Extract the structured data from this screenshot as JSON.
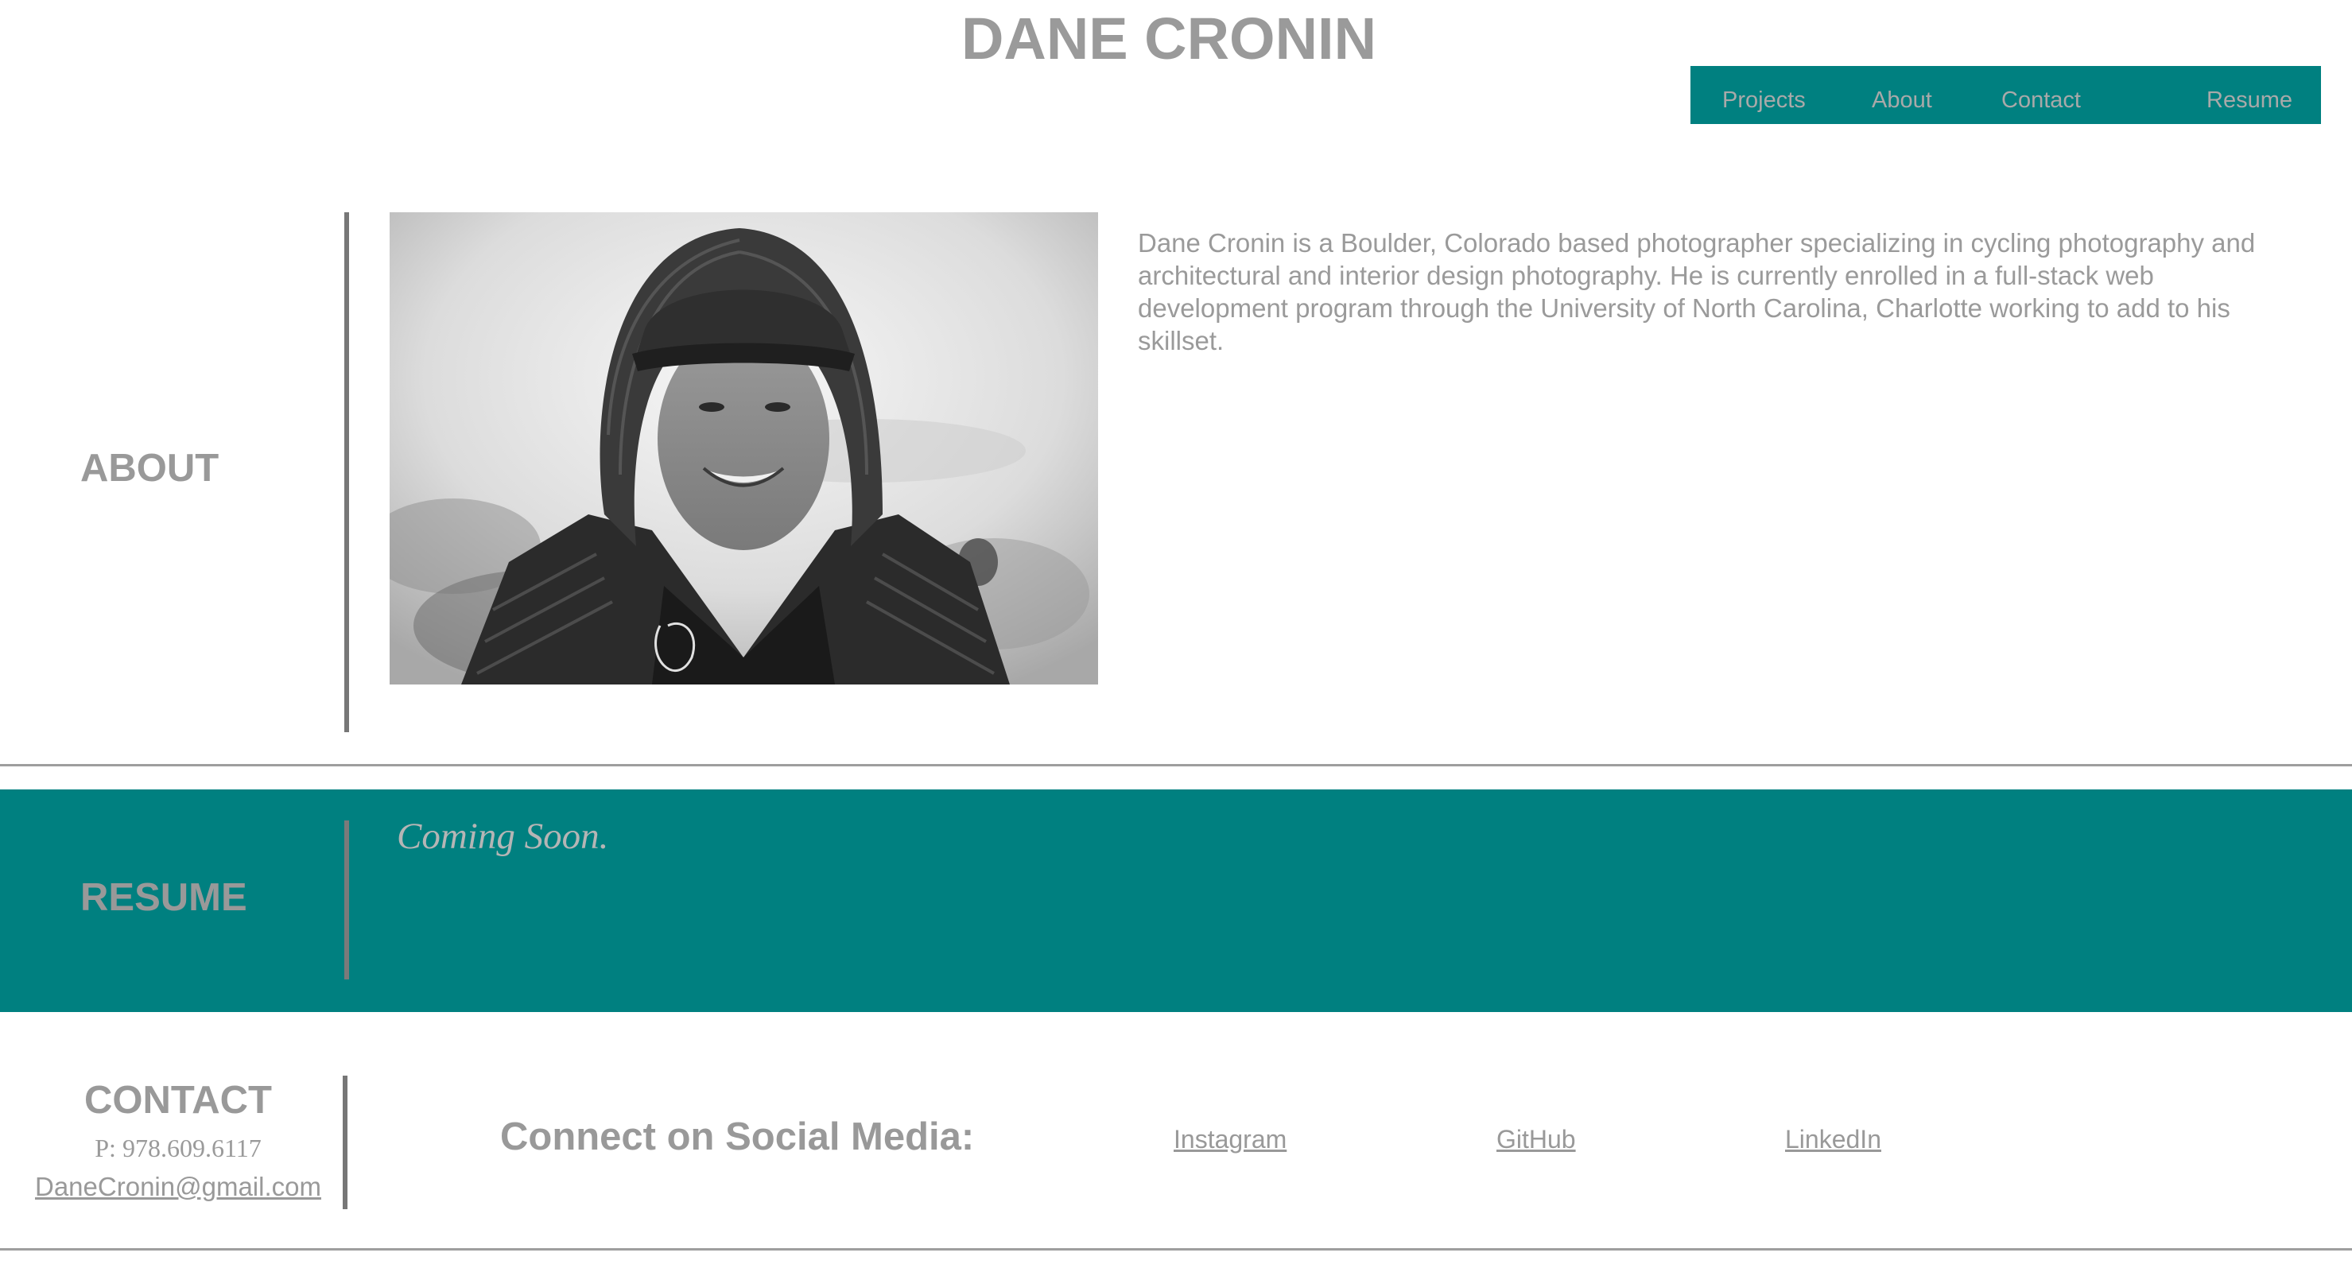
{
  "header": {
    "title": "DANE CRONIN",
    "nav": {
      "projects": "Projects",
      "about": "About",
      "contact": "Contact",
      "resume": "Resume"
    }
  },
  "about": {
    "label": "ABOUT",
    "bio": "Dane Cronin is a Boulder, Colorado based photographer specializing in cycling photography and architectural and interior design photography. He is currently enrolled in a full-stack web development program through the University of North Carolina, Charlotte working to add to his skillset."
  },
  "resume": {
    "label": "RESUME",
    "status": "Coming Soon."
  },
  "contact": {
    "label": "CONTACT",
    "phone": "P: 978.609.6117",
    "email": "DaneCronin@gmail.com",
    "social_heading": "Connect on Social Media:",
    "social_links": {
      "instagram": "Instagram",
      "github": "GitHub",
      "linkedin": "LinkedIn"
    }
  },
  "colors": {
    "accent": "#008080",
    "text": "#999999",
    "rule": "#9e9e9e"
  }
}
